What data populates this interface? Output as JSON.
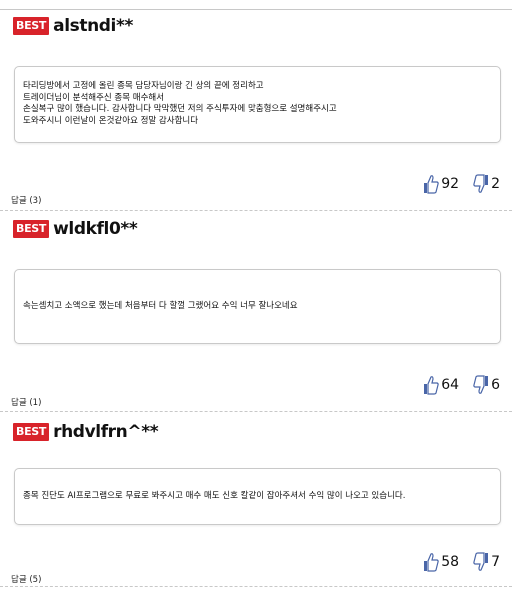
{
  "comments": [
    {
      "badge": "BEST",
      "username": "alstndi**",
      "lines": [
        "타리딩방에서 고정에 올린 종목 담당자님이랑 긴 상의 끝에 정리하고",
        "트레이더님이 분석해주신 종목 매수해서",
        "손실복구 많이 했습니다. 감사합니다 막막했던 저의 주식투자에 맞춤형으로 설명해주시고",
        "도와주시니 이런날이 온것같아요 정말 감사합니다"
      ],
      "likes": "92",
      "dislikes": "2",
      "reply_label": "답글 (3)"
    },
    {
      "badge": "BEST",
      "username": "wldkfl0**",
      "lines": [
        "속는셈치고 소액으로 했는데 처음부터 다 할껄 그랬어요 수익 너무 잘나오네요"
      ],
      "likes": "64",
      "dislikes": "6",
      "reply_label": "답글 (1)"
    },
    {
      "badge": "BEST",
      "username": "rhdvlfrn^**",
      "lines": [
        "종목 진단도 AI프로그램으로 무료로 봐주시고 매수 매도 신호 칼같이 잡아주셔서 수익 많이 나오고 있습니다."
      ],
      "likes": "58",
      "dislikes": "7",
      "reply_label": "답글 (5)"
    }
  ],
  "colors": {
    "badge": "#d8232a",
    "border": "#c9c9c9",
    "thumb": "#4a66a8"
  },
  "icons": {
    "like": "thumbs-up-icon",
    "dislike": "thumbs-down-icon"
  }
}
